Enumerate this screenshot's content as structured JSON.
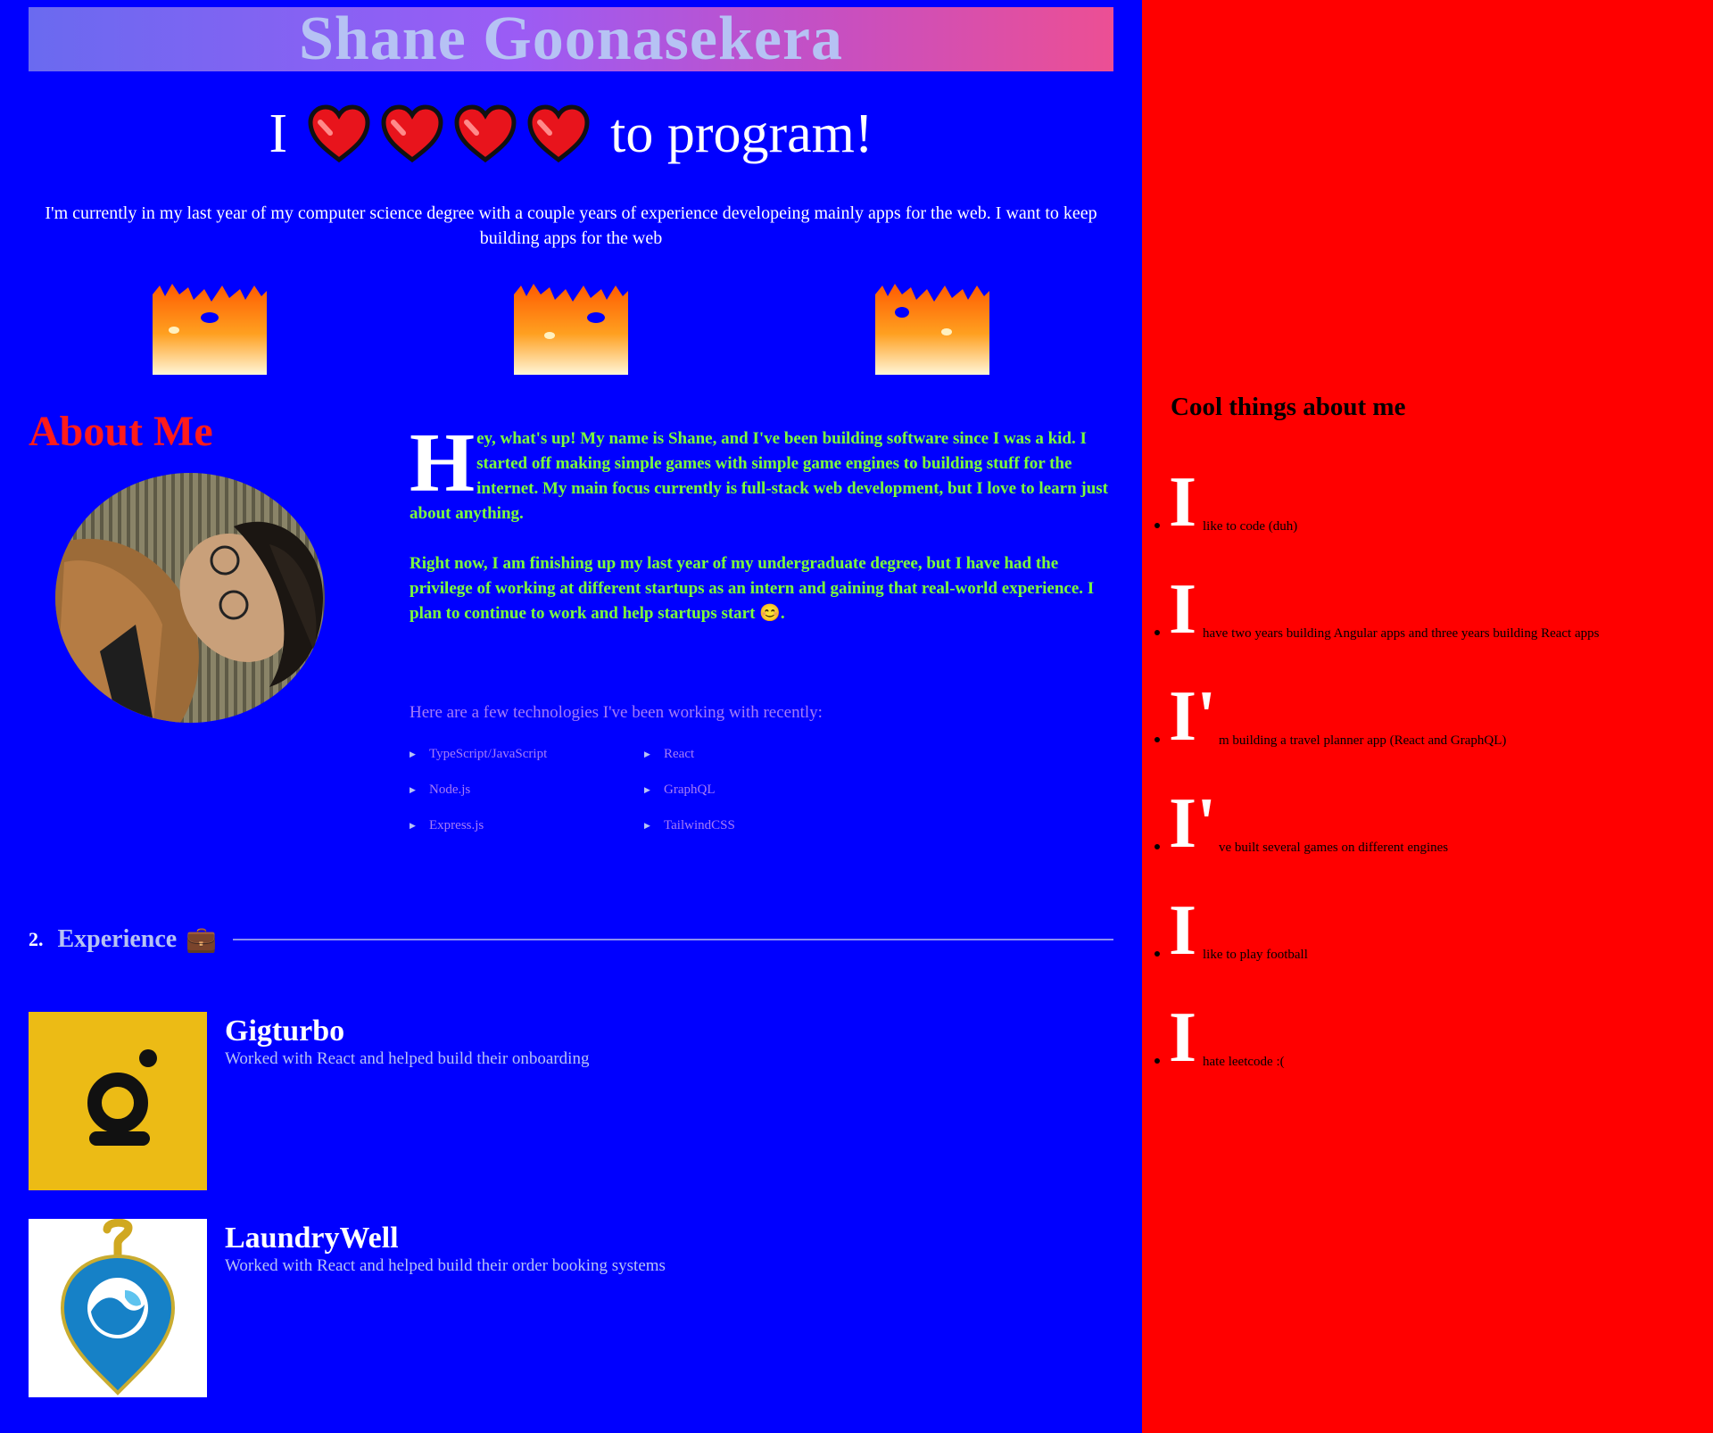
{
  "header": {
    "name": "Shane Goonasekera",
    "love_prefix": "I",
    "love_suffix": "to program!",
    "heart_count": 4,
    "intro": "I'm currently in my last year of my computer science degree with a couple years of experience developeing mainly apps for the web. I want to keep building apps for the web"
  },
  "about": {
    "title": "About Me",
    "dropcap": "H",
    "para1": "ey, what's up! My name is Shane, and I've been building software since I was a kid. I started off making simple games with simple game engines to building stuff for the internet. My main focus currently is full-stack web development, but I love to learn just about anything.",
    "para2": "Right now, I am finishing up my last year of my undergraduate degree, but I have had the privilege of working at different startups as an intern and gaining that real-world experience. I plan to continue to work and help startups start 😊.",
    "tech_intro": "Here are a few technologies I've been working with recently:",
    "tech": [
      "TypeScript/JavaScript",
      "React",
      "Node.js",
      "GraphQL",
      "Express.js",
      "TailwindCSS"
    ]
  },
  "experience": {
    "number": "2.",
    "title": "Experience",
    "emoji": "💼",
    "jobs": [
      {
        "name": "Gigturbo",
        "desc": "Worked with React and helped build their onboarding"
      },
      {
        "name": "LaundryWell",
        "desc": "Worked with React and helped build their order booking systems"
      }
    ]
  },
  "sidebar": {
    "title": "Cool things about me",
    "items": [
      {
        "cap": "I",
        "text": "like to code (duh)"
      },
      {
        "cap": "I",
        "text": "have two years building Angular apps and three years building React apps"
      },
      {
        "cap": "I'",
        "text": "m building a travel planner app (React and GraphQL)"
      },
      {
        "cap": "I'",
        "text": "ve built several games on different engines"
      },
      {
        "cap": "I",
        "text": "like to play football"
      },
      {
        "cap": "I",
        "text": "hate leetcode :("
      }
    ]
  },
  "colors": {
    "main_bg": "#0000ff",
    "side_bg": "#ff0000",
    "about_title": "#ff1b1b",
    "about_text": "#7cff3a",
    "tech_text": "#a57cf5"
  }
}
